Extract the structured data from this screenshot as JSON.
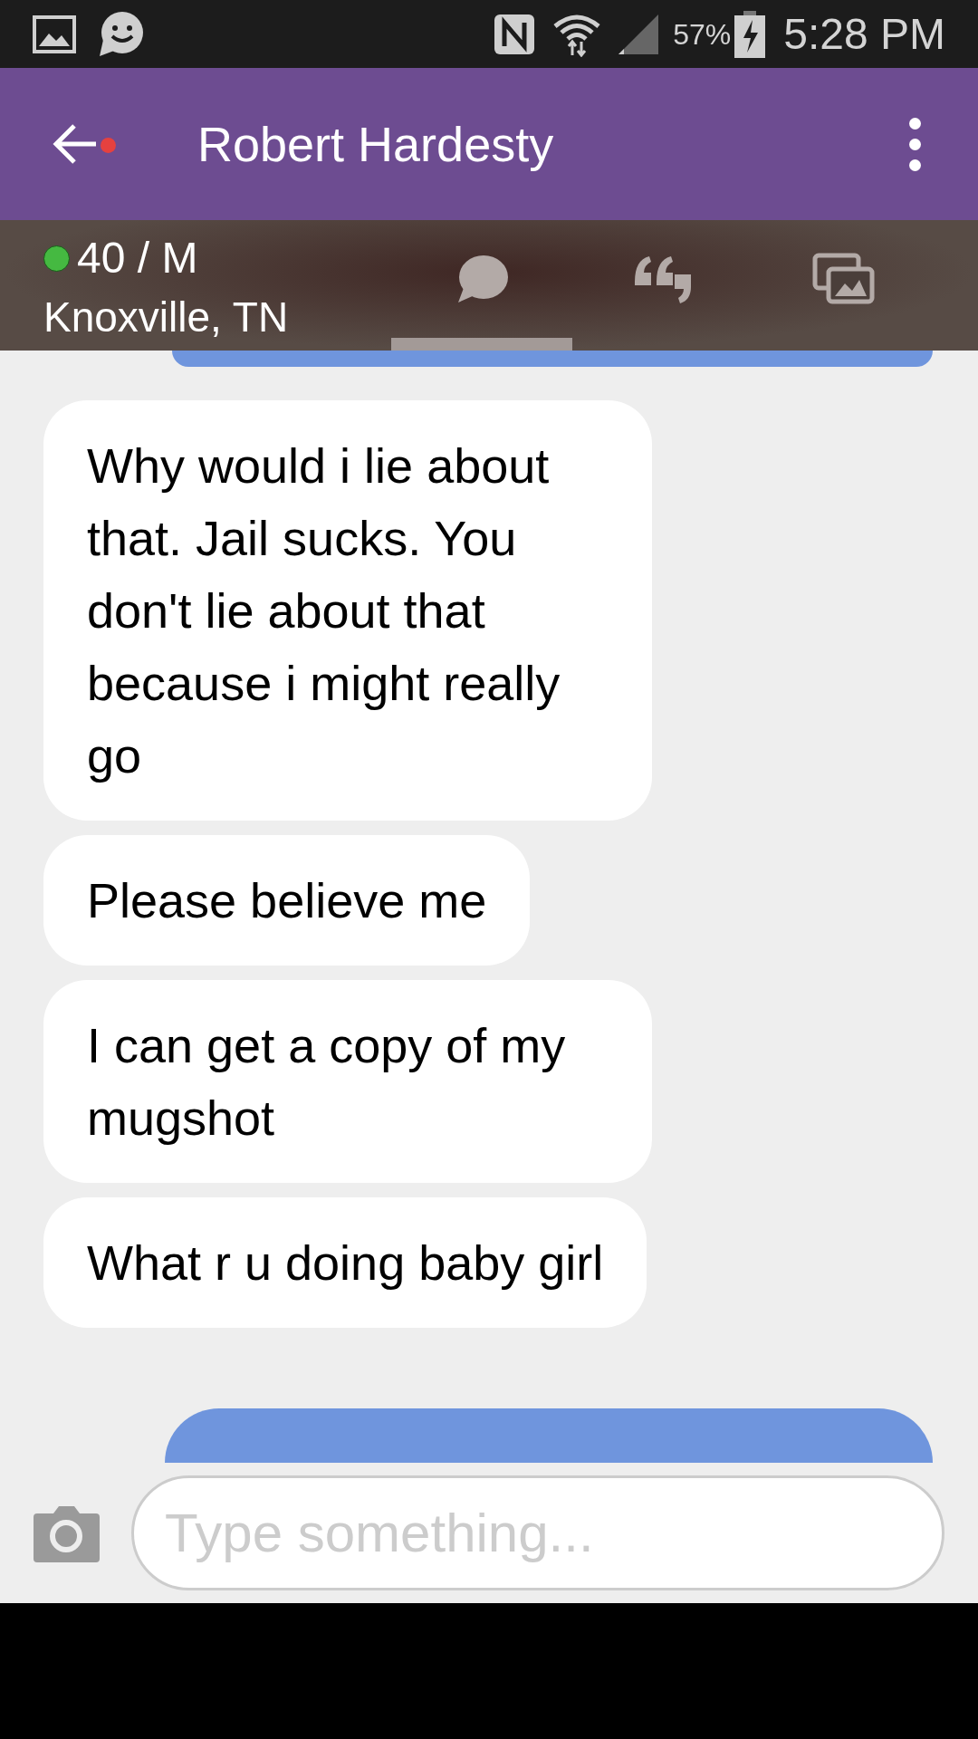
{
  "status_bar": {
    "battery": "57%",
    "time": "5:28 PM"
  },
  "header": {
    "title": "Robert Hardesty",
    "unread_dot": true
  },
  "profile": {
    "online": true,
    "age_gender": "40 / M",
    "location": "Knoxville, TN"
  },
  "tabs": [
    {
      "kind": "chat",
      "selected": true
    },
    {
      "kind": "quotes",
      "selected": false
    },
    {
      "kind": "photos",
      "selected": false
    }
  ],
  "messages": [
    {
      "kind": "sent_partial"
    },
    {
      "kind": "received",
      "text": "Why would i lie about that. Jail sucks. You don't lie about that because i might really go"
    },
    {
      "kind": "received",
      "text": "Please believe me"
    },
    {
      "kind": "received",
      "text": "I can get a copy of my mugshot"
    },
    {
      "kind": "received",
      "text": "What r u doing baby girl"
    },
    {
      "kind": "sent_partial"
    }
  ],
  "composer": {
    "placeholder": "Type something..."
  }
}
